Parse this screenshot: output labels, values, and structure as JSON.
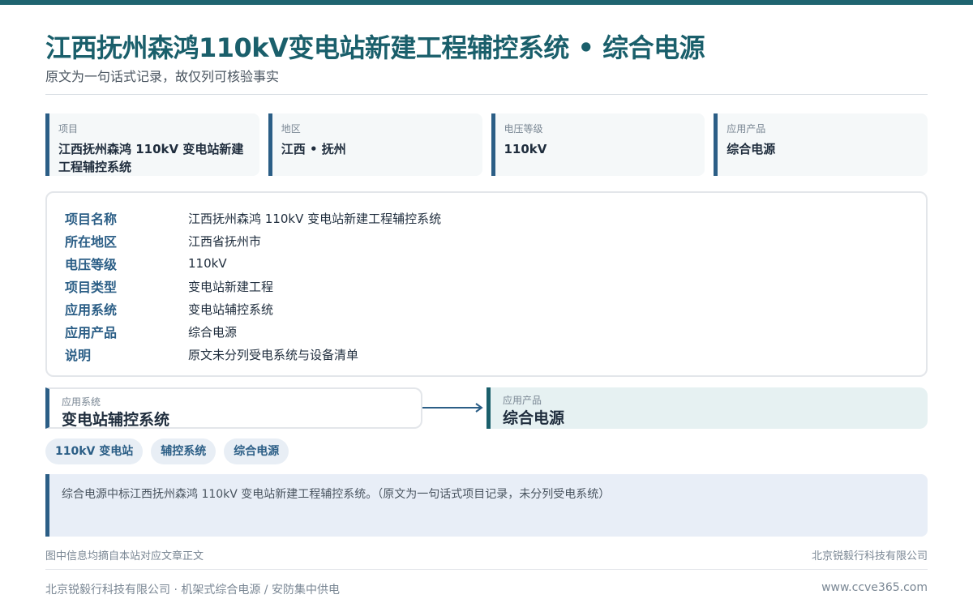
{
  "header": {
    "title": "江西抚州森鸿110kV变电站新建工程辅控系统 • 综合电源",
    "subtitle": "原文为一句话式记录，故仅列可核验事实"
  },
  "cards": [
    {
      "label": "项目",
      "value": "江西抚州森鸿 110kV 变电站新建工程辅控系统"
    },
    {
      "label": "地区",
      "value": "江西 • 抚州"
    },
    {
      "label": "电压等级",
      "value": "110kV"
    },
    {
      "label": "应用产品",
      "value": "综合电源"
    }
  ],
  "details": [
    {
      "key": "项目名称",
      "value": "江西抚州森鸿 110kV 变电站新建工程辅控系统"
    },
    {
      "key": "所在地区",
      "value": "江西省抚州市"
    },
    {
      "key": "电压等级",
      "value": "110kV"
    },
    {
      "key": "项目类型",
      "value": "变电站新建工程"
    },
    {
      "key": "应用系统",
      "value": "变电站辅控系统"
    },
    {
      "key": "应用产品",
      "value": "综合电源"
    },
    {
      "key": "说明",
      "value": "原文未分列受电系统与设备清单"
    }
  ],
  "flow": {
    "left": {
      "label": "应用系统",
      "value": "变电站辅控系统"
    },
    "right": {
      "label": "应用产品",
      "value": "综合电源"
    }
  },
  "tags": [
    "110kV 变电站",
    "辅控系统",
    "综合电源"
  ],
  "note": "综合电源中标江西抚州森鸿 110kV 变电站新建工程辅控系统。（原文为一句话式项目记录，未分列受电系统）",
  "footer": {
    "left": "图中信息均摘自本站对应文章正文",
    "right": "北京锐毅行科技有限公司",
    "bottom_left": "北京锐毅行科技有限公司 · 机架式综合电源 / 安防集中供电",
    "bottom_right": "www.ccve365.com"
  },
  "colors": {
    "accent": "#2b5e86",
    "title": "#1a5f6b",
    "topbar": "#1f6470"
  }
}
